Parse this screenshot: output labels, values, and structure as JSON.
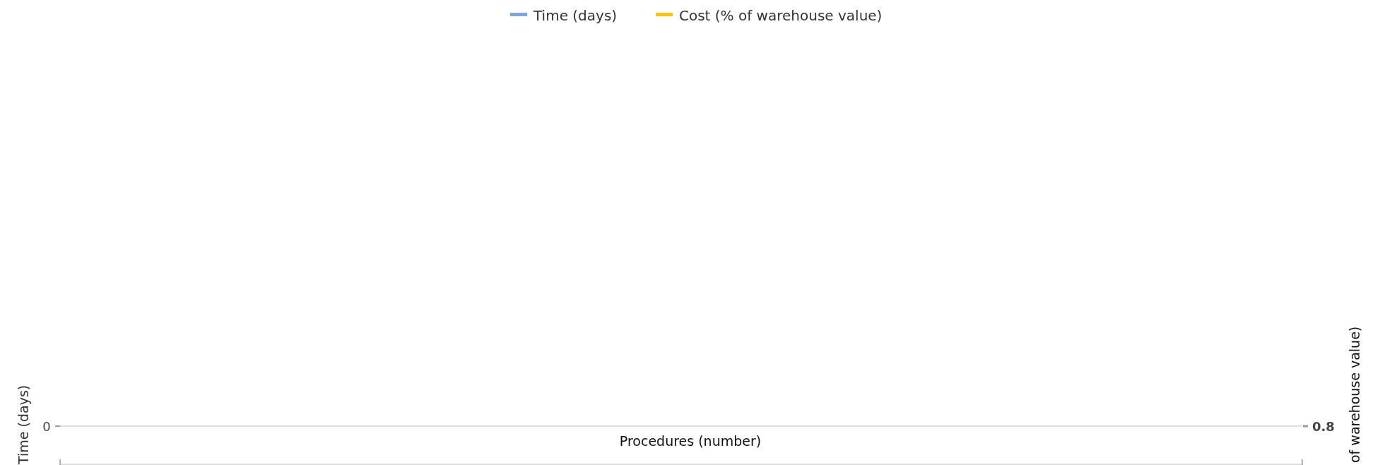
{
  "chart": {
    "legend": [
      {
        "name": "Time (days)",
        "color": "#7ba7e3"
      },
      {
        "name": "Cost (% of warehouse value)",
        "color": "#ffc20e"
      }
    ],
    "x_axis_title": "Procedures (number)",
    "left_axis": {
      "label": "Time (days)",
      "ticks": [
        "0"
      ]
    },
    "secondary_axis": {
      "label": "of warehouse value)",
      "ticks": [
        "0.8"
      ]
    }
  }
}
